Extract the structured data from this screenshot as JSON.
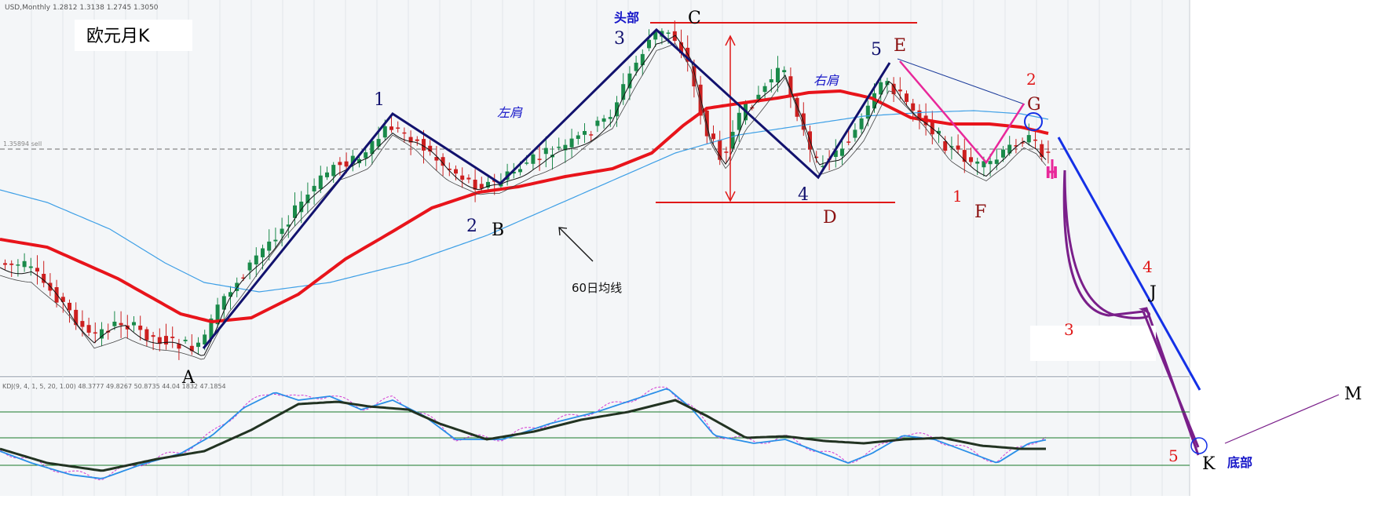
{
  "chart_data": {
    "type": "candlestick",
    "title": "欧元月K",
    "price_header": "USD,Monthly  1.2812 1.3138 1.2745 1.3050",
    "price_level_label": "1.35894 sell",
    "indicator_header": "KDJ(9, 4, 1, 5, 20, 1.00) 48.3777 49.8267 50.8735 44.04 1832 47.1854",
    "ma_label": "60日均线",
    "pattern_labels": {
      "head": "头部",
      "left_shoulder": "左肩",
      "right_shoulder": "右肩",
      "bottom": "底部"
    },
    "wave_numbers": {
      "up_1": "1",
      "up_2": "2",
      "up_3": "3",
      "up_4": "4",
      "up_5": "5",
      "down_1": "1",
      "down_2": "2",
      "down_3": "3",
      "down_4": "4",
      "down_5": "5"
    },
    "point_letters": {
      "A": "A",
      "B": "B",
      "C": "C",
      "D": "D",
      "E": "E",
      "F": "F",
      "G": "G",
      "H": "H",
      "J": "J",
      "K": "K",
      "M": "M"
    },
    "colors": {
      "bull": "#1a8a4a",
      "bear": "#cc1f1f",
      "ma_red": "#e8141b",
      "ma_blue": "#3d9fe6",
      "wave_navy": "#12126e",
      "projection_blue": "#1430e6",
      "projection_purple": "#7a1f8a",
      "magenta": "#e8289a",
      "level_red": "#e01818",
      "kdj_k": "#2a8fe8",
      "kdj_d": "#223322",
      "kdj_j": "#d33bd3",
      "kdj_levels": "#1a7a2a",
      "text_blue": "#1515c8",
      "text_red": "#e01818",
      "text_darkred": "#8a1010"
    }
  }
}
